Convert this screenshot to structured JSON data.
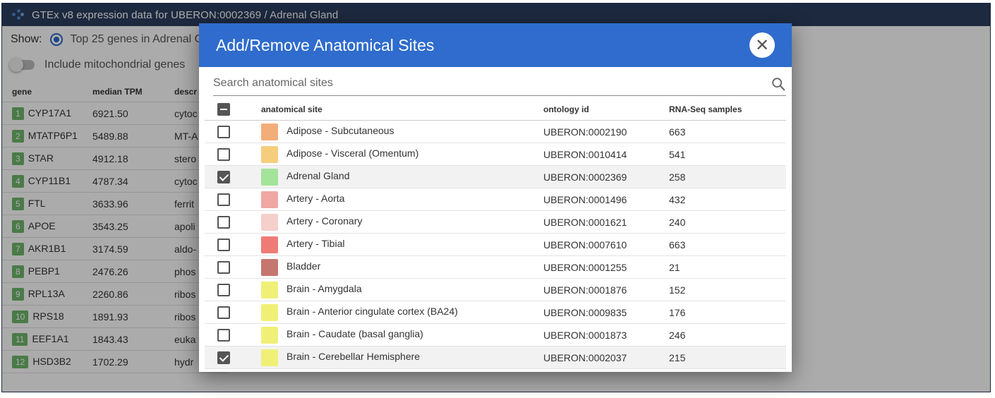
{
  "app": {
    "title": "GTEx v8 expression data for UBERON:0002369 / Adrenal Gland",
    "show_label": "Show:",
    "show_option": "Top 25 genes in Adrenal G",
    "mito_label": "Include mitochondrial genes",
    "gene_table": {
      "headers": [
        "gene",
        "median TPM",
        "descr"
      ],
      "rows": [
        {
          "rank": "1",
          "gene": "CYP17A1",
          "tpm": "6921.50",
          "desc": "cytoc"
        },
        {
          "rank": "2",
          "gene": "MTATP6P1",
          "tpm": "5489.88",
          "desc": "MT-A"
        },
        {
          "rank": "3",
          "gene": "STAR",
          "tpm": "4912.18",
          "desc": "stero"
        },
        {
          "rank": "4",
          "gene": "CYP11B1",
          "tpm": "4787.34",
          "desc": "cytoc"
        },
        {
          "rank": "5",
          "gene": "FTL",
          "tpm": "3633.96",
          "desc": "ferrit"
        },
        {
          "rank": "6",
          "gene": "APOE",
          "tpm": "3543.25",
          "desc": "apoli"
        },
        {
          "rank": "7",
          "gene": "AKR1B1",
          "tpm": "3174.59",
          "desc": "aldo-"
        },
        {
          "rank": "8",
          "gene": "PEBP1",
          "tpm": "2476.26",
          "desc": "phos"
        },
        {
          "rank": "9",
          "gene": "RPL13A",
          "tpm": "2260.86",
          "desc": "ribos"
        },
        {
          "rank": "10",
          "gene": "RPS18",
          "tpm": "1891.93",
          "desc": "ribos"
        },
        {
          "rank": "11",
          "gene": "EEF1A1",
          "tpm": "1843.43",
          "desc": "euka"
        },
        {
          "rank": "12",
          "gene": "HSD3B2",
          "tpm": "1702.29",
          "desc": "hydr"
        }
      ]
    }
  },
  "modal": {
    "title": "Add/Remove Anatomical Sites",
    "close_symbol": "✕",
    "search_placeholder": "Search anatomical sites",
    "search_icon": "search-icon",
    "headers": {
      "site": "anatomical site",
      "ontology": "ontology id",
      "samples": "RNA-Seq samples"
    },
    "select_all_state": "indeterminate",
    "rows": [
      {
        "checked": false,
        "color": "#f2ad78",
        "site": "Adipose - Subcutaneous",
        "ontology": "UBERON:0002190",
        "samples": "663"
      },
      {
        "checked": false,
        "color": "#f5cd7d",
        "site": "Adipose - Visceral (Omentum)",
        "ontology": "UBERON:0010414",
        "samples": "541"
      },
      {
        "checked": true,
        "color": "#a4e39a",
        "site": "Adrenal Gland",
        "ontology": "UBERON:0002369",
        "samples": "258"
      },
      {
        "checked": false,
        "color": "#f0a7a4",
        "site": "Artery - Aorta",
        "ontology": "UBERON:0001496",
        "samples": "432"
      },
      {
        "checked": false,
        "color": "#f5cfc9",
        "site": "Artery - Coronary",
        "ontology": "UBERON:0001621",
        "samples": "240"
      },
      {
        "checked": false,
        "color": "#ef7b76",
        "site": "Artery - Tibial",
        "ontology": "UBERON:0007610",
        "samples": "663"
      },
      {
        "checked": false,
        "color": "#c5766f",
        "site": "Bladder",
        "ontology": "UBERON:0001255",
        "samples": "21"
      },
      {
        "checked": false,
        "color": "#f0f077",
        "site": "Brain - Amygdala",
        "ontology": "UBERON:0001876",
        "samples": "152"
      },
      {
        "checked": false,
        "color": "#f0f077",
        "site": "Brain - Anterior cingulate cortex (BA24)",
        "ontology": "UBERON:0009835",
        "samples": "176"
      },
      {
        "checked": false,
        "color": "#f0f077",
        "site": "Brain - Caudate (basal ganglia)",
        "ontology": "UBERON:0001873",
        "samples": "246"
      },
      {
        "checked": true,
        "color": "#f0f077",
        "site": "Brain - Cerebellar Hemisphere",
        "ontology": "UBERON:0002037",
        "samples": "215"
      }
    ]
  }
}
